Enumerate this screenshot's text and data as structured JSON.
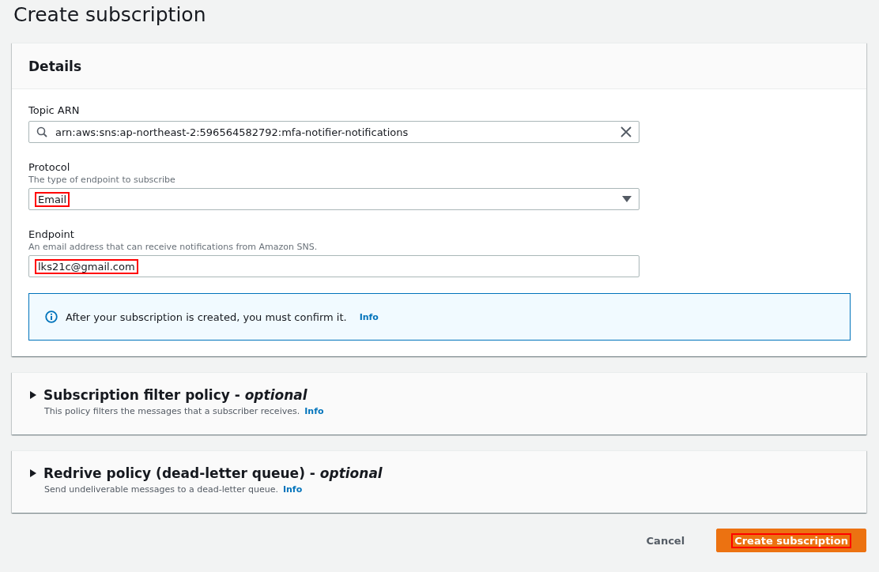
{
  "page_title": "Create subscription",
  "details": {
    "title": "Details",
    "topic_arn": {
      "label": "Topic ARN",
      "value": "arn:aws:sns:ap-northeast-2:596564582792:mfa-notifier-notifications"
    },
    "protocol": {
      "label": "Protocol",
      "description": "The type of endpoint to subscribe",
      "value": "Email",
      "highlighted": true
    },
    "endpoint": {
      "label": "Endpoint",
      "description": "An email address that can receive notifications from Amazon SNS.",
      "value": "lks21c@gmail.com",
      "highlighted": true
    },
    "alert": {
      "text": "After your subscription is created, you must confirm it.",
      "link": "Info"
    }
  },
  "sections": [
    {
      "title": "Subscription filter policy - *optional*",
      "description": "This policy filters the messages that a subscriber receives.",
      "link": "Info",
      "expanded": false
    },
    {
      "title": "Redrive policy (dead-letter queue) - *optional*",
      "description": "Send undeliverable messages to a dead-letter queue.",
      "link": "Info",
      "expanded": false
    }
  ],
  "buttons": [
    {
      "label": "Cancel",
      "kind": "link",
      "highlighted": false
    },
    {
      "label": "Create subscription",
      "kind": "primary",
      "highlighted": true
    }
  ]
}
